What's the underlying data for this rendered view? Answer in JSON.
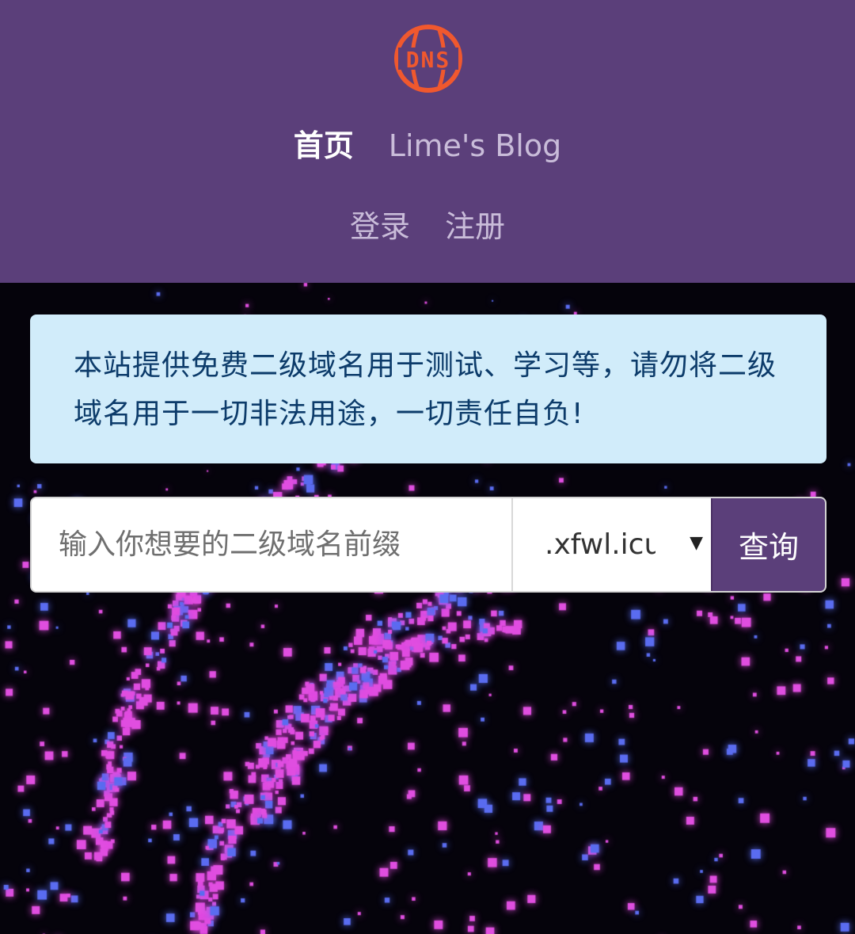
{
  "header": {
    "logo_text": "DNS",
    "nav_primary": [
      {
        "label": "首页",
        "active": true
      },
      {
        "label": "Lime's Blog",
        "active": false
      }
    ],
    "nav_secondary": [
      {
        "label": "登录"
      },
      {
        "label": "注册"
      }
    ]
  },
  "notice": {
    "text": "本站提供免费二级域名用于测试、学习等，请勿将二级域名用于一切非法用途，一切责任自负!"
  },
  "search": {
    "placeholder": "输入你想要的二级域名前缀",
    "value": "",
    "suffix_selected": ".xfwl.icu",
    "button_label": "查询"
  },
  "colors": {
    "header_bg": "#5b3f7a",
    "logo": "#f0582e",
    "notice_bg": "#d1ecfa",
    "notice_text": "#0c3b6a",
    "button_bg": "#5b3f7a",
    "page_bg": "#05030b",
    "particle_pink": "#e04ee0",
    "particle_blue": "#5a6cf0"
  },
  "icons": {
    "logo": "dns-globe-logo",
    "caret": "caret-down-icon"
  }
}
